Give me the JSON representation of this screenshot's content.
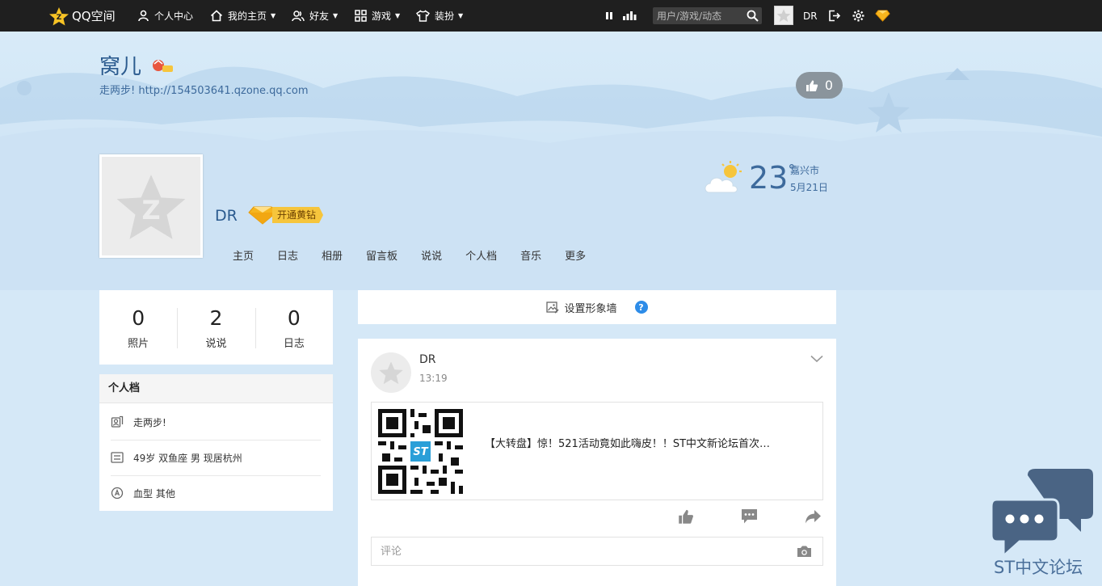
{
  "topbar": {
    "logo_text": "QQ空间",
    "nav": [
      {
        "label": "个人中心",
        "icon": "person-icon"
      },
      {
        "label": "我的主页",
        "icon": "home-icon",
        "caret": "▼"
      },
      {
        "label": "好友",
        "icon": "friends-icon",
        "caret": "▼"
      },
      {
        "label": "游戏",
        "icon": "grid-icon",
        "caret": "▼"
      },
      {
        "label": "装扮",
        "icon": "shirt-icon",
        "caret": "▼"
      }
    ],
    "search_placeholder": "用户/游戏/动态",
    "user_name": "DR"
  },
  "header": {
    "title": "窝儿",
    "subtitle": "走两步! http://154503641.qzone.qq.com",
    "like_count": "0"
  },
  "profile": {
    "nickname": "DR",
    "vip_label": "开通黄钻"
  },
  "weather": {
    "temperature": "23",
    "degree": "°",
    "city": "嘉兴市",
    "date": "5月21日"
  },
  "tabs": [
    "主页",
    "日志",
    "相册",
    "留言板",
    "说说",
    "个人档",
    "音乐",
    "更多"
  ],
  "stats": [
    {
      "value": "0",
      "label": "照片"
    },
    {
      "value": "2",
      "label": "说说"
    },
    {
      "value": "0",
      "label": "日志"
    }
  ],
  "profile_card": {
    "heading": "个人档",
    "rows": [
      {
        "icon": "person-card-icon",
        "text": "走两步!"
      },
      {
        "icon": "id-card-icon",
        "text": "49岁  双鱼座 男 现居杭州"
      },
      {
        "icon": "blood-drop-icon",
        "text": "血型 其他"
      }
    ]
  },
  "wall": {
    "label": "设置形象墙",
    "help": "?"
  },
  "feed": {
    "author": "DR",
    "time": "13:19",
    "link_text": "【大转盘】惊！521活动竟如此嗨皮！！ST中文新论坛首次…",
    "comment_placeholder": "评论"
  },
  "watermark": {
    "text": "ST中文论坛"
  },
  "colors": {
    "topbar_bg": "#1f1f1f",
    "page_bg": "#d5e8f7",
    "title_blue": "#2b5b8f",
    "vip_gold": "#f6c53c",
    "help_blue": "#2d8ce8"
  }
}
